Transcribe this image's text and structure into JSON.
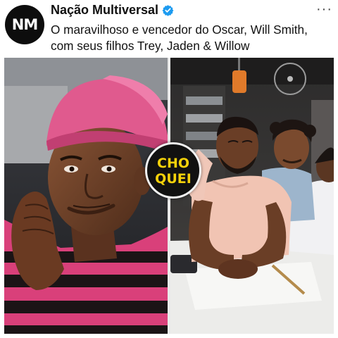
{
  "post": {
    "avatar_initials": "NM",
    "account_name": "Nação Multiversal",
    "caption": "O maravilhoso e vencedor do Oscar, Will Smith, com seus filhos Trey, Jaden & Willow",
    "more_label": "···"
  },
  "stamp": {
    "line1": "CHO",
    "line2": "QUEI"
  },
  "colors": {
    "verified_blue": "#1d9bf0",
    "stamp_yellow": "#f5d20a",
    "shirt_pink": "#e0447a",
    "cap_pink": "#e05a8e"
  },
  "icons": {
    "verified": "verified-badge-icon",
    "more": "more-options-icon"
  }
}
